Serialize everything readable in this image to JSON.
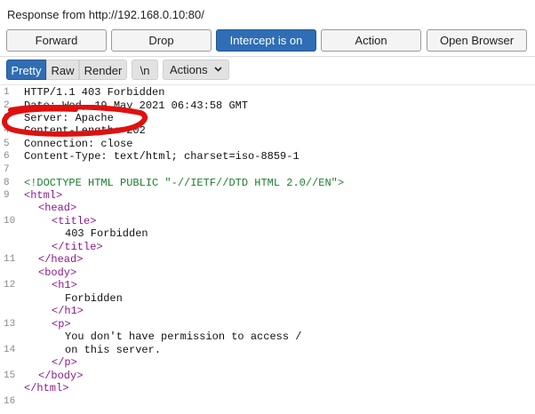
{
  "header": {
    "title": "Response from http://192.168.0.10:80/"
  },
  "toolbar": {
    "forward": "Forward",
    "drop": "Drop",
    "intercept": "Intercept is on",
    "action": "Action",
    "open_browser": "Open Browser"
  },
  "view_tabs": {
    "pretty": "Pretty",
    "raw": "Raw",
    "render": "Render",
    "newline": "\\n",
    "actions": "Actions"
  },
  "colors": {
    "accent": "#2f6db4",
    "tag": "#8b1a8b",
    "doctype": "#1a7f2e",
    "annotation": "#e01010"
  },
  "editor": {
    "numbers": [
      "1",
      "2",
      "3",
      "4",
      "5",
      "6",
      "7",
      "8",
      "9",
      "10",
      "11",
      "12",
      "13",
      "14",
      "15",
      "16"
    ],
    "lines": [
      "HTTP/1.1 403 Forbidden",
      "Date: Wed, 19 May 2021 06:43:58 GMT",
      "Server: Apache",
      "Content-Length: 202",
      "Connection: close",
      "Content-Type: text/html; charset=iso-8859-1",
      "",
      "<!DOCTYPE HTML PUBLIC \"-//IETF//DTD HTML 2.0//EN\">",
      "<html>",
      "<head>",
      "<title>",
      "403 Forbidden",
      "</title>",
      "</head>",
      "<body>",
      "<h1>",
      "Forbidden",
      "</h1>",
      "<p>",
      "You don't have permission to access /",
      "on this server.",
      "</p>",
      "</body>",
      "</html>"
    ]
  }
}
